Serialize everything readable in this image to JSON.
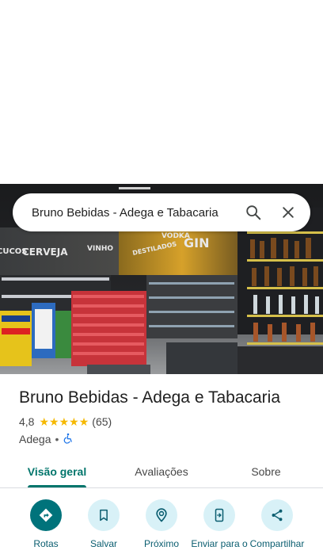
{
  "search": {
    "query": "Bruno Bebidas - Adega e Tabacaria"
  },
  "hero": {
    "signs": [
      "CUCOS",
      "CERVEJA",
      "VINHO",
      "DESTILADOS",
      "VODKA",
      "GIN"
    ]
  },
  "place": {
    "name": "Bruno Bebidas - Adega e Tabacaria",
    "rating": "4,8",
    "stars": 5,
    "review_count": "(65)",
    "category": "Adega",
    "separator": "•"
  },
  "tabs": [
    {
      "label": "Visão geral",
      "active": true
    },
    {
      "label": "Avaliações",
      "active": false
    },
    {
      "label": "Sobre",
      "active": false
    }
  ],
  "actions": [
    {
      "label": "Rotas",
      "icon": "directions-icon"
    },
    {
      "label": "Salvar",
      "icon": "bookmark-icon"
    },
    {
      "label": "Próximo",
      "icon": "nearby-icon"
    },
    {
      "label": "Enviar para o",
      "icon": "send-to-phone-icon"
    },
    {
      "label": "Compartilhar",
      "icon": "share-icon"
    }
  ],
  "colors": {
    "accent": "#00756b",
    "star": "#f5b800",
    "action_bg": "#d8f1f7",
    "action_primary_bg": "#00737b",
    "action_label": "#0b5e70"
  }
}
